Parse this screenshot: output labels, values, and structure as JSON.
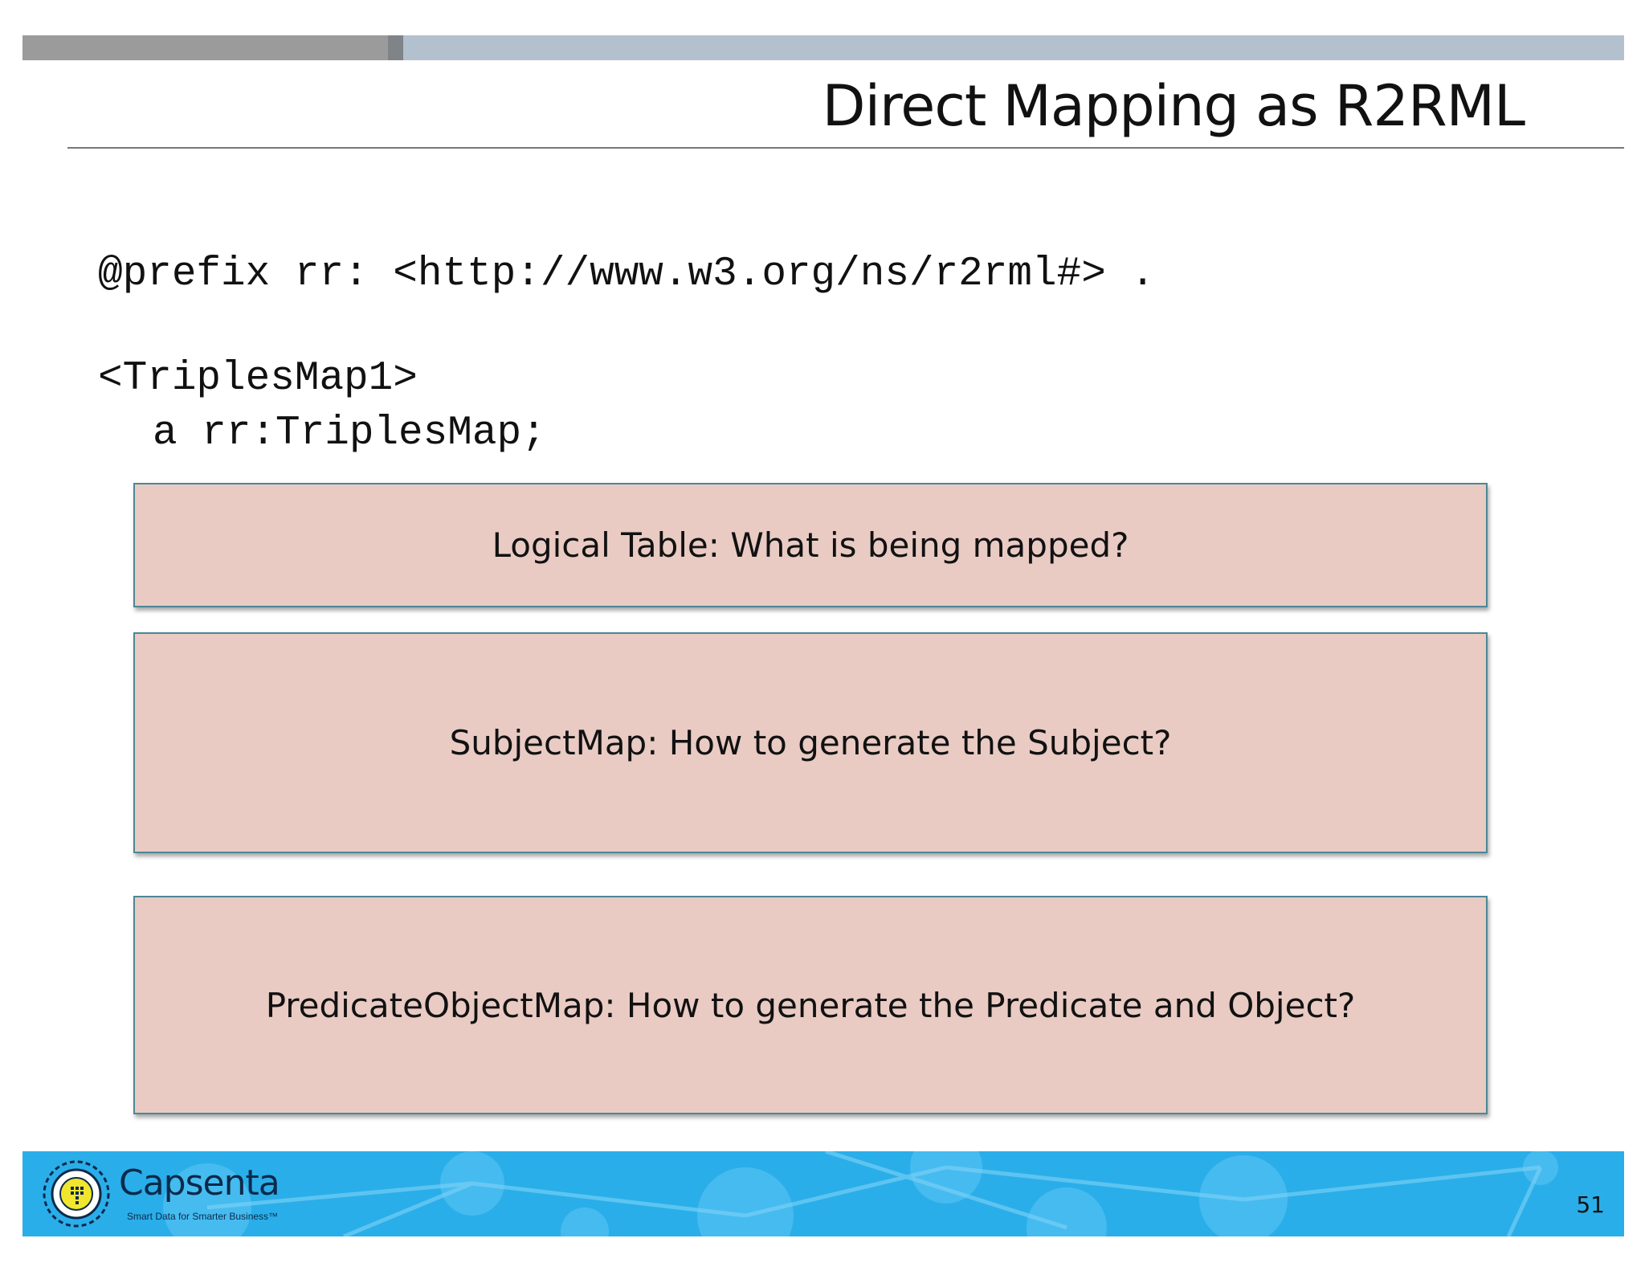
{
  "slide": {
    "title": "Direct Mapping as R2RML",
    "page_number": "51"
  },
  "code": {
    "prefix_line": "@prefix rr: <http://www.w3.org/ns/r2rml#> .",
    "triples_map_line": "<TriplesMap1>",
    "type_line": "a rr:TriplesMap;"
  },
  "boxes": [
    {
      "text": "Logical Table:  What is being mapped?"
    },
    {
      "text": "SubjectMap: How to generate the Subject?"
    },
    {
      "text": "PredicateObjectMap:  How to generate the Predicate and Object?"
    }
  ],
  "footer": {
    "brand_name": "Capsenta",
    "tagline": "Smart Data for Smarter Business™"
  },
  "colors": {
    "top_bar": "#b3c0cd",
    "box_fill": "#e9cbc4",
    "box_border": "#4c8796",
    "footer_bg": "#2aaee9"
  }
}
